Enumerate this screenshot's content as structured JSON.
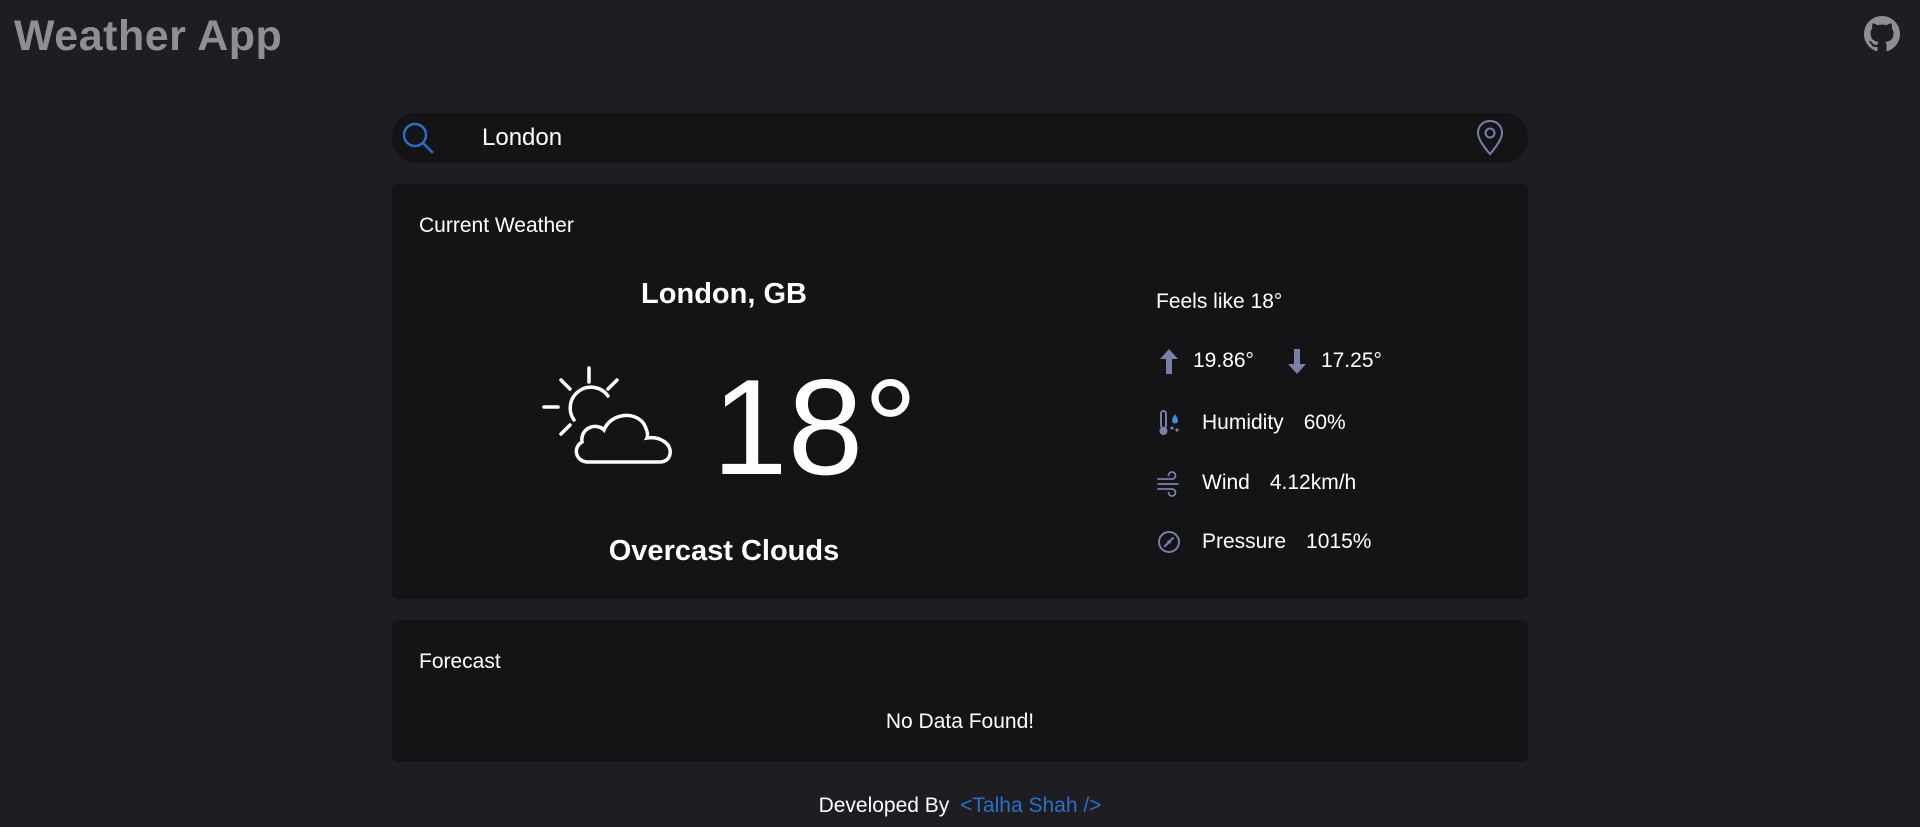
{
  "header": {
    "title": "Weather App",
    "github_icon": "github-icon"
  },
  "search": {
    "value": "London",
    "search_icon": "search-icon",
    "location_icon": "location-pin-icon"
  },
  "current": {
    "section_title": "Current Weather",
    "city": "London, GB",
    "temperature": "18°",
    "description": "Overcast Clouds",
    "weather_icon": "partly-cloudy-icon",
    "feels_like": "Feels like 18°",
    "max_temp": "19.86°",
    "min_temp": "17.25°",
    "humidity_label": "Humidity",
    "humidity_value": "60%",
    "wind_label": "Wind",
    "wind_value": "4.12km/h",
    "pressure_label": "Pressure",
    "pressure_value": "1015%"
  },
  "forecast": {
    "section_title": "Forecast",
    "empty_message": "No Data Found!"
  },
  "footer": {
    "prefix": "Developed By",
    "author": "<Talha Shah />"
  },
  "colors": {
    "background": "#1e1e22",
    "card": "#141416",
    "accent": "#2a6fc9",
    "icon_muted": "#7a7ea8"
  }
}
